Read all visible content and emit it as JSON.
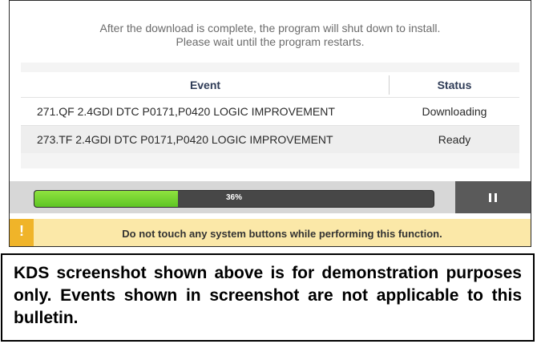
{
  "header": {
    "line1": "After the download is complete, the program will shut down to install.",
    "line2": "Please wait until the program restarts."
  },
  "table": {
    "columns": {
      "event": "Event",
      "status": "Status"
    },
    "rows": [
      {
        "event": "271.QF 2.4GDI DTC P0171,P0420 LOGIC IMPROVEMENT",
        "status": "Downloading"
      },
      {
        "event": "273.TF 2.4GDI DTC P0171,P0420 LOGIC IMPROVEMENT",
        "status": "Ready"
      }
    ]
  },
  "progress": {
    "percent_label": "36%",
    "value": 0.36
  },
  "warning": {
    "icon": "!",
    "text": "Do not touch any system buttons while performing this function."
  },
  "note": {
    "text": "KDS screenshot shown above is for demonstration purposes only. Events shown in screenshot are not applicable to this bulletin."
  },
  "colors": {
    "progress_fill": "#6fd22e",
    "warning_bg": "#fbe8a8",
    "warning_icon_bg": "#f0b429",
    "header_text": "#2e3b56"
  }
}
